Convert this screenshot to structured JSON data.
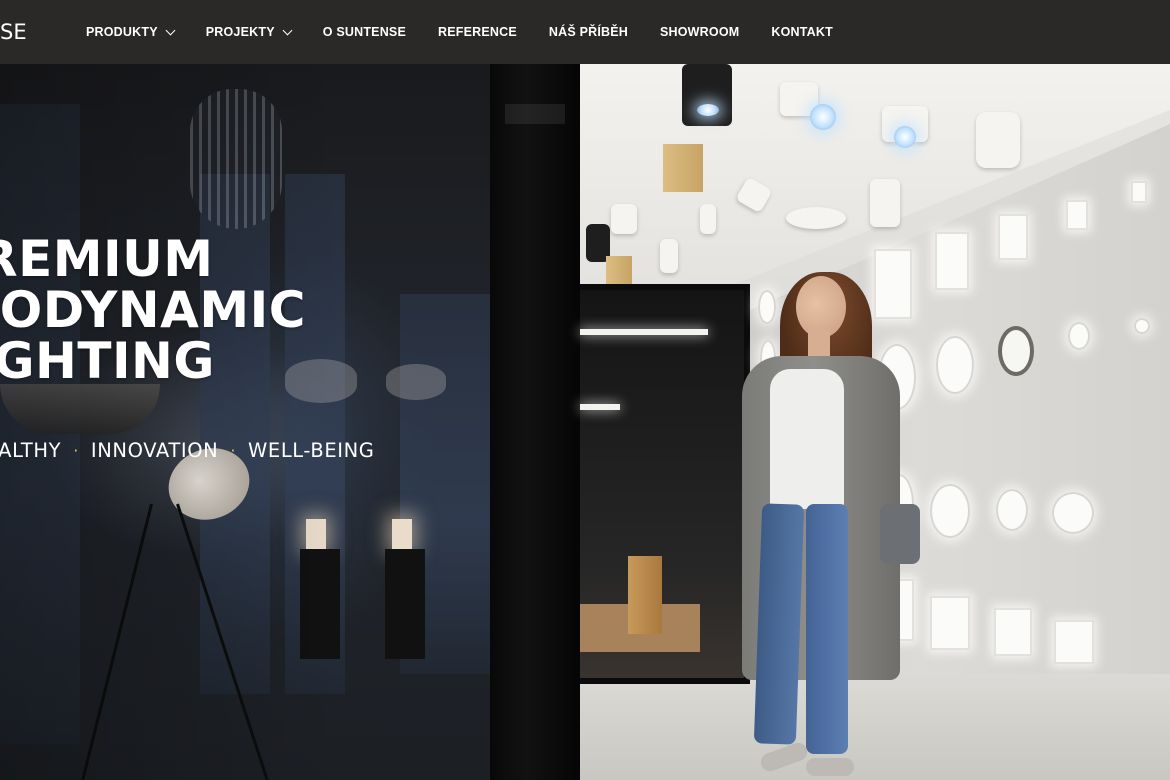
{
  "brand": {
    "logo_text": "SE"
  },
  "nav": {
    "items": [
      {
        "label": "PRODUKTY",
        "has_dropdown": true
      },
      {
        "label": "PROJEKTY",
        "has_dropdown": true
      },
      {
        "label": "O SUNTENSE",
        "has_dropdown": false
      },
      {
        "label": "REFERENCE",
        "has_dropdown": false
      },
      {
        "label": "NÁŠ PŘÍBĚH",
        "has_dropdown": false
      },
      {
        "label": "SHOWROOM",
        "has_dropdown": false
      },
      {
        "label": "KONTAKT",
        "has_dropdown": false
      }
    ]
  },
  "hero": {
    "headline_lines": [
      "PREMIUM",
      "BIODYNAMIC",
      "LIGHTING"
    ],
    "tagline": [
      "HEALTHY",
      "INNOVATION",
      "WELL-BEING"
    ],
    "tagline_separator": "·",
    "background_image": "lighting-showroom-with-woman"
  },
  "colors": {
    "nav_bg": "#2b2927",
    "separator_dot": "#e4c24a",
    "text": "#ffffff"
  }
}
